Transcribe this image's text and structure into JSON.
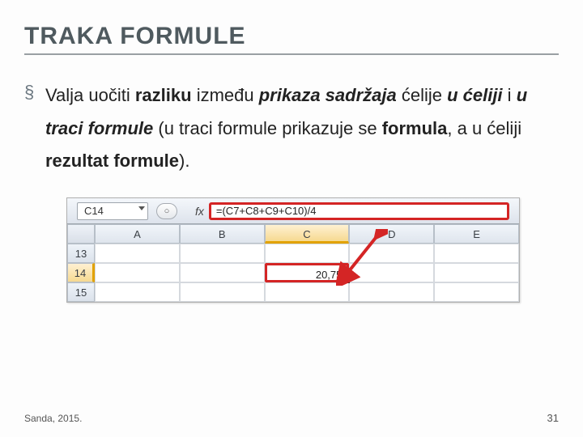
{
  "title": "TRAKA FORMULE",
  "bullet_glyph": "§",
  "paragraph": {
    "pre": "Valja uočiti ",
    "razliku": "razliku",
    "sp1": " između ",
    "prikaza": "prikaza sadržaja",
    "sp2": " ćelije ",
    "u_celiji": "u ćeliji",
    "sp3": " i ",
    "u_traci": "u traci formule",
    "sp4": " (u traci formule prikazuje se ",
    "formula": "formula",
    "sp5": ", a u ćeliji ",
    "rezultat": "rezultat  formule",
    "end": ")."
  },
  "excel": {
    "namebox": "C14",
    "fx": "fx",
    "formula": "=(C7+C8+C9+C10)/4",
    "pill": "○",
    "columns": [
      "A",
      "B",
      "C",
      "D",
      "E"
    ],
    "rows": [
      "13",
      "14",
      "15"
    ],
    "active_value": "20,75",
    "active_col_index": 2,
    "active_row_index": 1
  },
  "footer": {
    "left": "Sanda, 2015.",
    "right": "31"
  }
}
